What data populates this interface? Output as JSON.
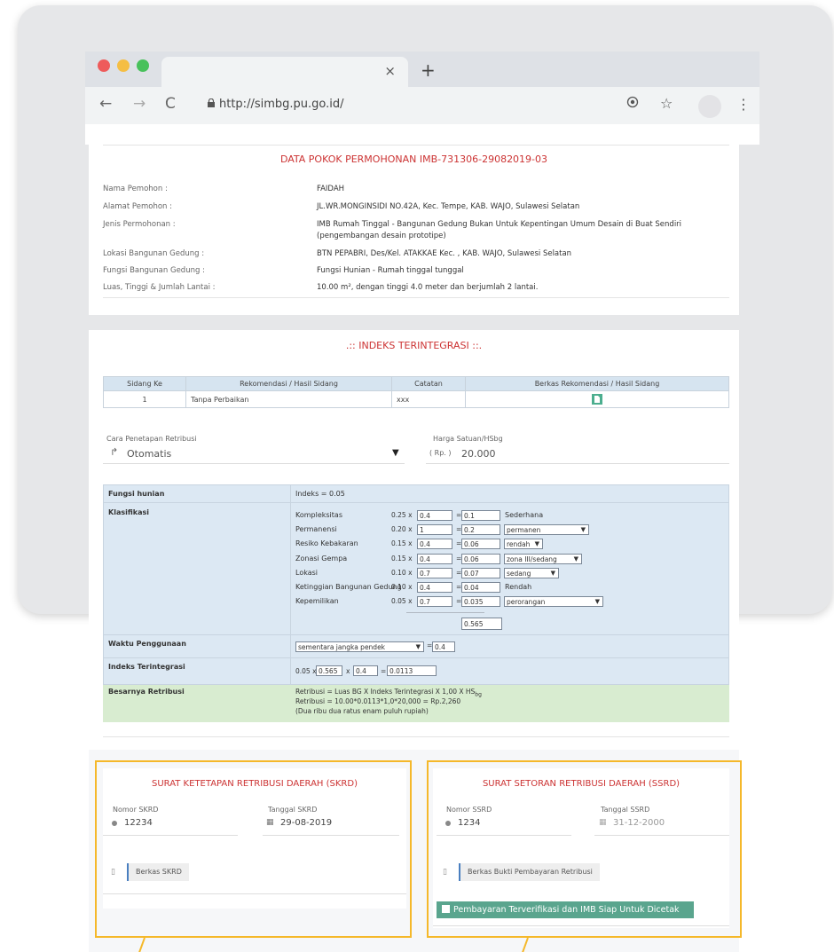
{
  "browser": {
    "tab_close": "×",
    "new_tab": "+",
    "back": "←",
    "forward": "→",
    "reload": "C",
    "url": "http://simbg.pu.go.id/",
    "lock_icon": "lock-icon",
    "traffic_lights": [
      "#ee5b5b",
      "#f5be43",
      "#48c15b"
    ]
  },
  "permohonan": {
    "title": "DATA POKOK PERMOHONAN IMB-731306-29082019-03",
    "rows": [
      {
        "label": "Nama Pemohon :",
        "value": "FAIDAH"
      },
      {
        "label": "Alamat Pemohon :",
        "value": "JL.WR.MONGINSIDI NO.42A, Kec. Tempe, KAB. WAJO, Sulawesi Selatan"
      },
      {
        "label": "Jenis Permohonan :",
        "value": "IMB Rumah Tinggal - Bangunan Gedung Bukan Untuk Kepentingan Umum Desain di Buat Sendiri",
        "value2": "(pengembangan desain prototipe)"
      },
      {
        "label": "Lokasi Bangunan Gedung :",
        "value": "BTN PEPABRI, Des/Kel. ATAKKAE Kec. , KAB. WAJO, Sulawesi Selatan"
      },
      {
        "label": "Fungsi Bangunan Gedung :",
        "value": "Fungsi Hunian - Rumah tinggal tunggal"
      },
      {
        "label": "Luas, Tinggi & Jumlah Lantai :",
        "value": "10.00 m², dengan tinggi 4.0 meter dan berjumlah 2 lantai."
      }
    ]
  },
  "indeks": {
    "title": ".:: INDEKS TERINTEGRASI ::.",
    "table_headers": [
      "Sidang Ke",
      "Rekomendasi / Hasil Sidang",
      "Catatan",
      "Berkas Rekomendasi / Hasil Sidang"
    ],
    "table_rows": [
      {
        "sidang": "1",
        "rekomendasi": "Tanpa Perbaikan",
        "catatan": "xxx"
      }
    ],
    "cara_label": "Cara Penetapan Retribusi",
    "cara_value": "Otomatis",
    "harga_label": "Harga Satuan/HSbg",
    "harga_prefix": "( Rp. )",
    "harga_value": "20.000"
  },
  "kalkulasi": {
    "fungsi_label": "Fungsi hunian",
    "fungsi_value": "Indeks = 0.05",
    "klasifikasi_label": "Klasifikasi",
    "items": [
      {
        "name": "Kompleksitas",
        "weight": "0.25 x",
        "factor": "0.4",
        "result": "0.1",
        "level": "Sederhana",
        "select": false
      },
      {
        "name": "Permanensi",
        "weight": "0.20 x",
        "factor": "1",
        "result": "0.2",
        "level": "permanen",
        "select": true
      },
      {
        "name": "Resiko Kebakaran",
        "weight": "0.15 x",
        "factor": "0.4",
        "result": "0.06",
        "level": "rendah",
        "select": true
      },
      {
        "name": "Zonasi Gempa",
        "weight": "0.15 x",
        "factor": "0.4",
        "result": "0.06",
        "level": "zona III/sedang",
        "select": true
      },
      {
        "name": "Lokasi",
        "weight": "0.10 x",
        "factor": "0.7",
        "result": "0.07",
        "level": "sedang",
        "select": true
      },
      {
        "name": "Ketinggian Bangunan Gedung",
        "weight": "0.10 x",
        "factor": "0.4",
        "result": "0.04",
        "level": "Rendah",
        "select": false
      },
      {
        "name": "Kepemilikan",
        "weight": "0.05 x",
        "factor": "0.7",
        "result": "0.035",
        "level": "perorangan",
        "select": true
      }
    ],
    "total": "0.565",
    "waktu_label": "Waktu Penggunaan",
    "waktu_value": "sementara jangka pendek",
    "waktu_result": "0.4",
    "indeks_label": "Indeks Terintegrasi",
    "indeks_a": "0.05 x",
    "indeks_b": "0.565",
    "indeks_c": "0.4",
    "indeks_result": "0.0113",
    "retribusi_label": "Besarnya Retribusi",
    "retribusi_line1": "Retribusi = Luas BG X Indeks Terintegrasi X 1,00 X HS",
    "retribusi_sub": "bg",
    "retribusi_line2": "Retribusi = 10.00*0.0113*1,0*20,000 = Rp.2,260",
    "retribusi_line3": "(Dua ribu dua ratus enam puluh rupiah)"
  },
  "skrd": {
    "title": "SURAT KETETAPAN RETRIBUSI DAERAH (SKRD)",
    "nomor_label": "Nomor SKRD",
    "nomor_value": "12234",
    "tanggal_label": "Tanggal SKRD",
    "tanggal_value": "29-08-2019",
    "berkas_label": "Berkas SKRD"
  },
  "ssrd": {
    "title": "SURAT SETORAN RETRIBUSI DAERAH (SSRD)",
    "nomor_label": "Nomor SSRD",
    "nomor_value": "1234",
    "tanggal_label": "Tanggal SSRD",
    "tanggal_value": "31-12-2000",
    "berkas_label": "Berkas Bukti Pembayaran Retribusi",
    "verified_label": "Pembayaran Terverifikasi dan IMB Siap Untuk Dicetak"
  },
  "colors": {
    "accent": "#f5b82a",
    "title_red": "#c33",
    "verified_green": "#5aa58e"
  }
}
